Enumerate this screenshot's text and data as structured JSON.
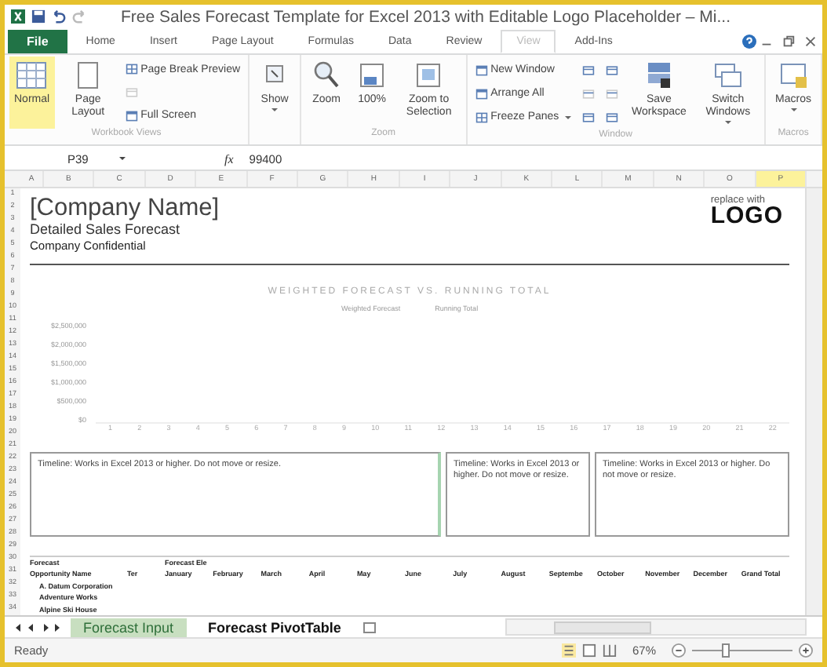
{
  "window": {
    "title": "Free Sales Forecast Template for Excel 2013 with Editable Logo Placeholder – Mi..."
  },
  "tabs": [
    {
      "label": "File",
      "kind": "file",
      "selected": false
    },
    {
      "label": "Home",
      "kind": "tab",
      "selected": false
    },
    {
      "label": "Insert",
      "kind": "tab",
      "selected": false
    },
    {
      "label": "Page Layout",
      "kind": "tab",
      "selected": false
    },
    {
      "label": "Formulas",
      "kind": "tab",
      "selected": false
    },
    {
      "label": "Data",
      "kind": "tab",
      "selected": false
    },
    {
      "label": "Review",
      "kind": "tab",
      "selected": false
    },
    {
      "label": "View",
      "kind": "tab",
      "selected": true
    },
    {
      "label": "Add-Ins",
      "kind": "tab",
      "selected": false
    }
  ],
  "ribbon": [
    {
      "name": "Workbook Views",
      "items": [
        {
          "kind": "large",
          "label": "Normal",
          "selected": true
        },
        {
          "kind": "large",
          "label": "Page Layout",
          "selected": false
        },
        {
          "kind": "stack",
          "rows": [
            {
              "kind": "button",
              "label": "Page Break Preview"
            },
            {
              "kind": "blank"
            },
            {
              "kind": "button",
              "label": "Full Screen"
            }
          ]
        }
      ]
    },
    {
      "items": [
        {
          "kind": "large",
          "label": "Show"
        }
      ]
    },
    {
      "name": "Zoom",
      "items": [
        {
          "kind": "large",
          "label": "Zoom"
        },
        {
          "kind": "large",
          "label": "100%"
        },
        {
          "kind": "large",
          "label": "Zoom to Selection"
        }
      ]
    },
    {
      "name": "Window",
      "items": [
        {
          "kind": "stack",
          "rows": [
            {
              "kind": "button",
              "label": "New Window"
            },
            {
              "kind": "button",
              "label": "Arrange All"
            },
            {
              "kind": "button",
              "label": "Freeze Panes"
            }
          ]
        },
        {
          "kind": "icons"
        },
        {
          "kind": "icons"
        },
        {
          "kind": "large",
          "label": "Save Workspace"
        },
        {
          "kind": "large",
          "label": "Switch Windows"
        }
      ]
    },
    {
      "name": "Macros",
      "items": [
        {
          "kind": "large",
          "label": "Macros"
        }
      ]
    }
  ],
  "formula_bar": {
    "name_box": "P39",
    "fx": "fx",
    "value": "99400"
  },
  "columns": [
    {
      "label": "A",
      "selected": false
    },
    {
      "label": "B",
      "selected": false
    },
    {
      "label": "C",
      "selected": false
    },
    {
      "label": "D",
      "selected": false
    },
    {
      "label": "E",
      "selected": false
    },
    {
      "label": "F",
      "selected": false
    },
    {
      "label": "G",
      "selected": false
    },
    {
      "label": "H",
      "selected": false
    },
    {
      "label": "I",
      "selected": false
    },
    {
      "label": "J",
      "selected": false
    },
    {
      "label": "K",
      "selected": false
    },
    {
      "label": "L",
      "selected": false
    },
    {
      "label": "M",
      "selected": false
    },
    {
      "label": "N",
      "selected": false
    },
    {
      "label": "O",
      "selected": false
    },
    {
      "label": "P",
      "selected": true
    }
  ],
  "rows": [
    "1",
    "2",
    "3",
    "4",
    "5",
    "6",
    "7",
    "8",
    "9",
    "10",
    "11",
    "12",
    "13",
    "14",
    "15",
    "16",
    "17",
    "18",
    "19",
    "20",
    "21",
    "22",
    "23",
    "24",
    "25",
    "26",
    "27",
    "28",
    "29",
    "30",
    "31",
    "32",
    "33",
    "34"
  ],
  "sheet": {
    "company": "[Company Name]",
    "subtitle": "Detailed Sales Forecast",
    "confidential": "Company Confidential",
    "logo_hint": "replace with",
    "logo": "LOGO"
  },
  "chart": {
    "title": "WEIGHTED FORECAST VS. RUNNING TOTAL",
    "legend": [
      "Weighted Forecast",
      "Running Total"
    ],
    "y_labels": [
      "$2,500,000",
      "$2,000,000",
      "$1,500,000",
      "$1,000,000",
      "$500,000",
      "$0"
    ],
    "x_labels": [
      "1",
      "2",
      "3",
      "4",
      "5",
      "6",
      "7",
      "8",
      "9",
      "10",
      "11",
      "12",
      "13",
      "14",
      "15",
      "16",
      "17",
      "18",
      "19",
      "20",
      "21",
      "22"
    ]
  },
  "timelines": [
    "Timeline: Works in Excel 2013 or higher. Do not move or resize.",
    "Timeline: Works in Excel 2013 or higher. Do not move or resize.",
    "Timeline: Works in Excel 2013 or higher. Do not move or resize."
  ],
  "pivot": {
    "label_1": "Forecast",
    "label_2": "Forecast Ele",
    "columns": [
      "Opportunity Name",
      "Ter",
      "January",
      "February",
      "March",
      "April",
      "May",
      "June",
      "July",
      "August",
      "Septembe",
      "October",
      "November",
      "December",
      "Grand Total"
    ],
    "rows": [
      "A. Datum Corporation",
      "Adventure Works",
      "Alpine Ski House"
    ]
  },
  "sheet_tabs": [
    {
      "label": "Forecast Input",
      "selected": true
    },
    {
      "label": "Forecast PivotTable",
      "selected": false
    }
  ],
  "status_bar": {
    "status": "Ready",
    "zoom": "67%",
    "level": 0.33
  }
}
